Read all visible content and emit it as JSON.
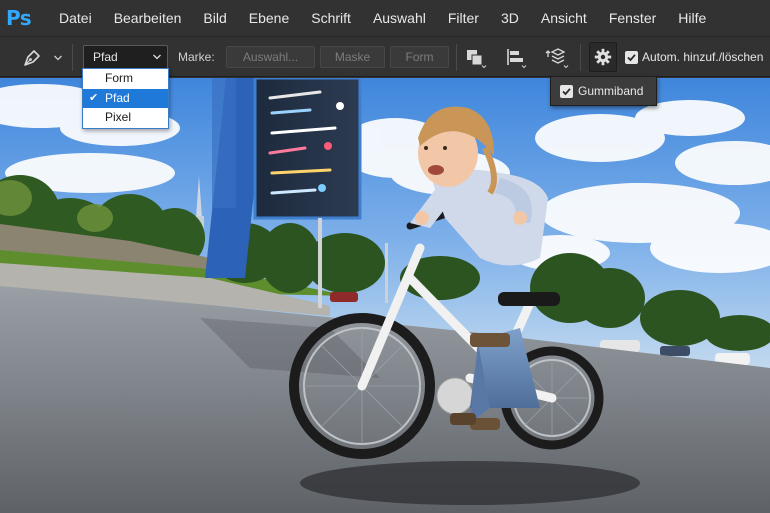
{
  "app": {
    "logo_text": "Ps",
    "brand_color": "#31a8ff"
  },
  "menubar": {
    "items": [
      "Datei",
      "Bearbeiten",
      "Bild",
      "Ebene",
      "Schrift",
      "Auswahl",
      "Filter",
      "3D",
      "Ansicht",
      "Fenster",
      "Hilfe"
    ]
  },
  "options_bar": {
    "tool_icon": "pen-tool-icon",
    "mode_select": {
      "value": "Pfad",
      "options": [
        "Form",
        "Pfad",
        "Pixel"
      ],
      "selected_index": 1
    },
    "marke_label": "Marke:",
    "buttons": {
      "auswahl": "Auswahl...",
      "maske": "Maske",
      "form": "Form"
    },
    "icons": {
      "path_operations": "path-operations-icon",
      "path_alignment": "path-alignment-icon",
      "path_arrangement": "path-arrangement-icon",
      "settings": "gear-icon"
    },
    "auto_add_delete": {
      "label": "Autom. hinzuf./löschen",
      "checked": true
    }
  },
  "settings_flyout": {
    "gummiband": {
      "label": "Gummiband",
      "checked": true
    }
  },
  "colors": {
    "ui_background": "#323232",
    "selection_blue": "#1e79d9",
    "sky": "#5f9be3",
    "road": "#7a7e84"
  }
}
